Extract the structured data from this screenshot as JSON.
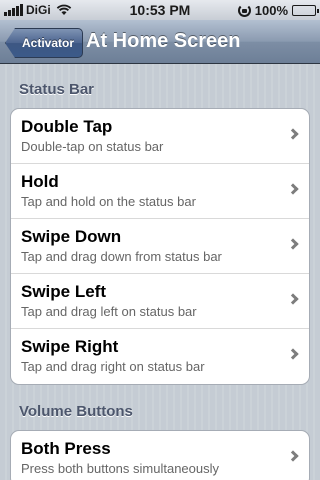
{
  "status_bar": {
    "carrier": "DiGi",
    "time": "10:53 PM",
    "battery": "100%"
  },
  "nav": {
    "back_label": "Activator",
    "title": "At Home Screen"
  },
  "sections": [
    {
      "header": "Status Bar",
      "items": [
        {
          "title": "Double Tap",
          "subtitle": "Double-tap on status bar"
        },
        {
          "title": "Hold",
          "subtitle": "Tap and hold on the status bar"
        },
        {
          "title": "Swipe Down",
          "subtitle": "Tap and drag down from status bar"
        },
        {
          "title": "Swipe Left",
          "subtitle": "Tap and drag left on status bar"
        },
        {
          "title": "Swipe Right",
          "subtitle": "Tap and drag right on status bar"
        }
      ]
    },
    {
      "header": "Volume Buttons",
      "items": [
        {
          "title": "Both Press",
          "subtitle": "Press both buttons simultaneously"
        }
      ]
    }
  ]
}
